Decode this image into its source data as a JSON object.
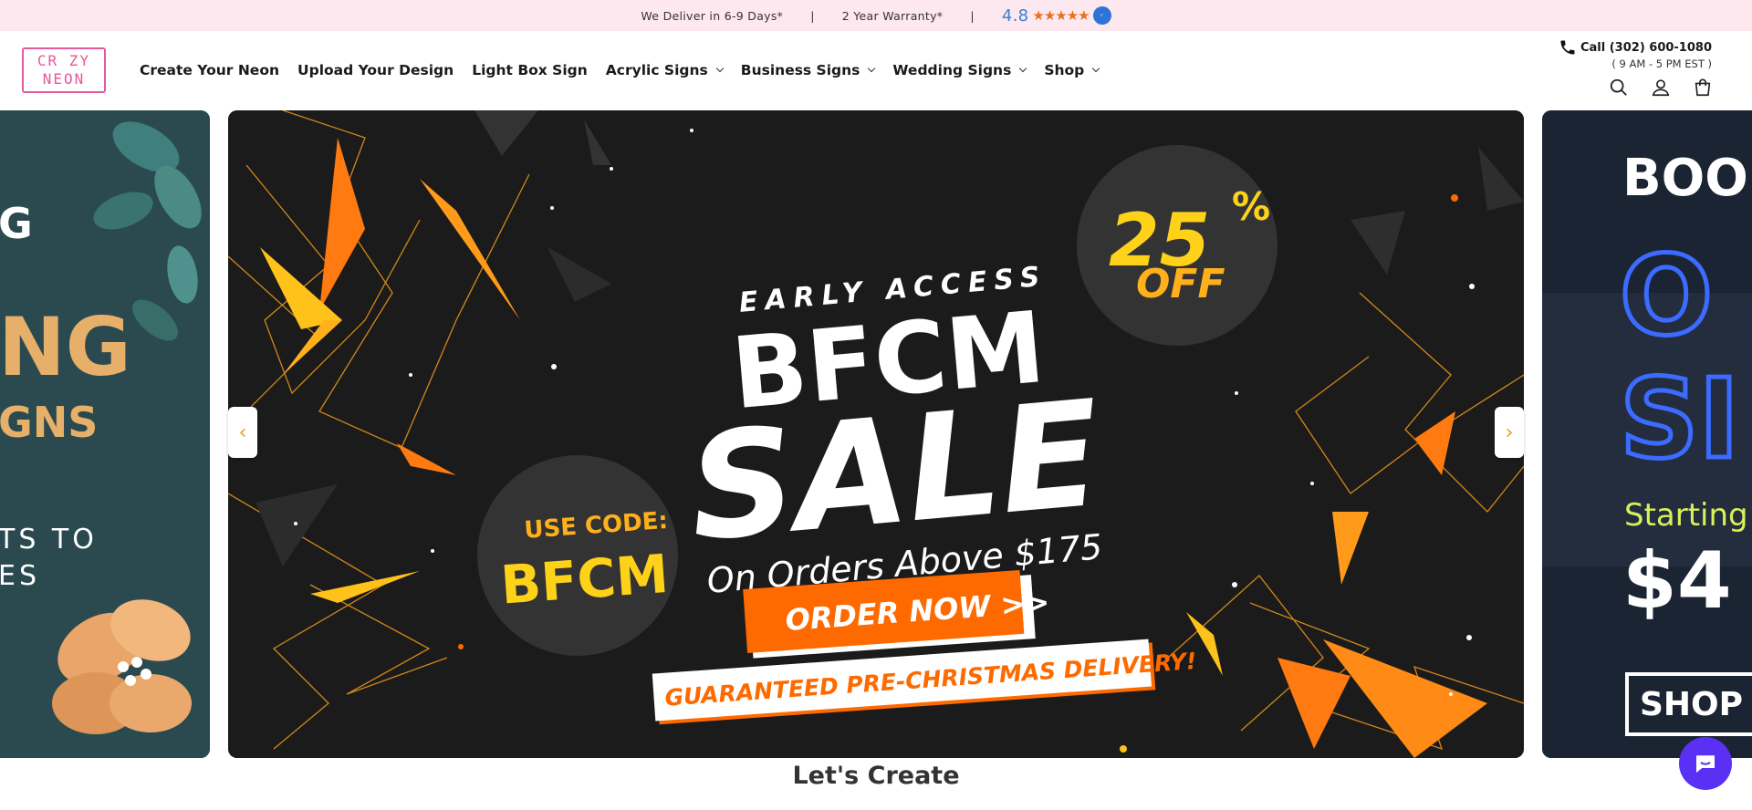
{
  "announcement": {
    "delivery": "We Deliver in 6-9 Days*",
    "separator": "|",
    "warranty": "2 Year Warranty*",
    "rating": "4.8",
    "stars": "★★★★★"
  },
  "logo": {
    "line1": "CR ZY",
    "line2": "NEON"
  },
  "nav": {
    "items": [
      {
        "label": "Create Your Neon",
        "dropdown": false
      },
      {
        "label": "Upload Your Design",
        "dropdown": false
      },
      {
        "label": "Light Box Sign",
        "dropdown": false
      },
      {
        "label": "Acrylic Signs",
        "dropdown": true
      },
      {
        "label": "Business Signs",
        "dropdown": true
      },
      {
        "label": "Wedding Signs",
        "dropdown": true
      },
      {
        "label": "Shop",
        "dropdown": true
      }
    ]
  },
  "contact": {
    "call": "Call (302) 600-1080",
    "hours": "( 9 AM - 5 PM EST )"
  },
  "slides": {
    "left": {
      "line1": "G",
      "line2": "NG",
      "line3": "GNS",
      "line4": "TS TO",
      "line5": "ES"
    },
    "main": {
      "discount_number": "25",
      "discount_percent": "%",
      "discount_off": "OFF",
      "early_access": "EARLY ACCESS",
      "bfcm": "BFCM",
      "sale": "SALE",
      "orders_above": "On Orders Above $175",
      "use_code": "USE CODE:",
      "code": "BFCM",
      "cta": "ORDER NOW >>",
      "guarantee": "GUARANTEED PRE-CHRISTMAS DELIVERY!"
    },
    "right": {
      "line1": "BOO",
      "line2": "O",
      "line3": "SI",
      "starting": "Starting",
      "price": "$4",
      "shop": "SHOP"
    }
  },
  "carousel": {
    "prev": "‹",
    "next": "›"
  },
  "section": {
    "title": "Let's Create"
  },
  "colors": {
    "announce_bg": "#fde8ef",
    "brand_pink": "#e45a9b",
    "accent_orange": "#f26b0f",
    "accent_yellow": "#ffcc1a",
    "rating_blue": "#3b7fd8",
    "chat_purple": "#5a31f4"
  }
}
